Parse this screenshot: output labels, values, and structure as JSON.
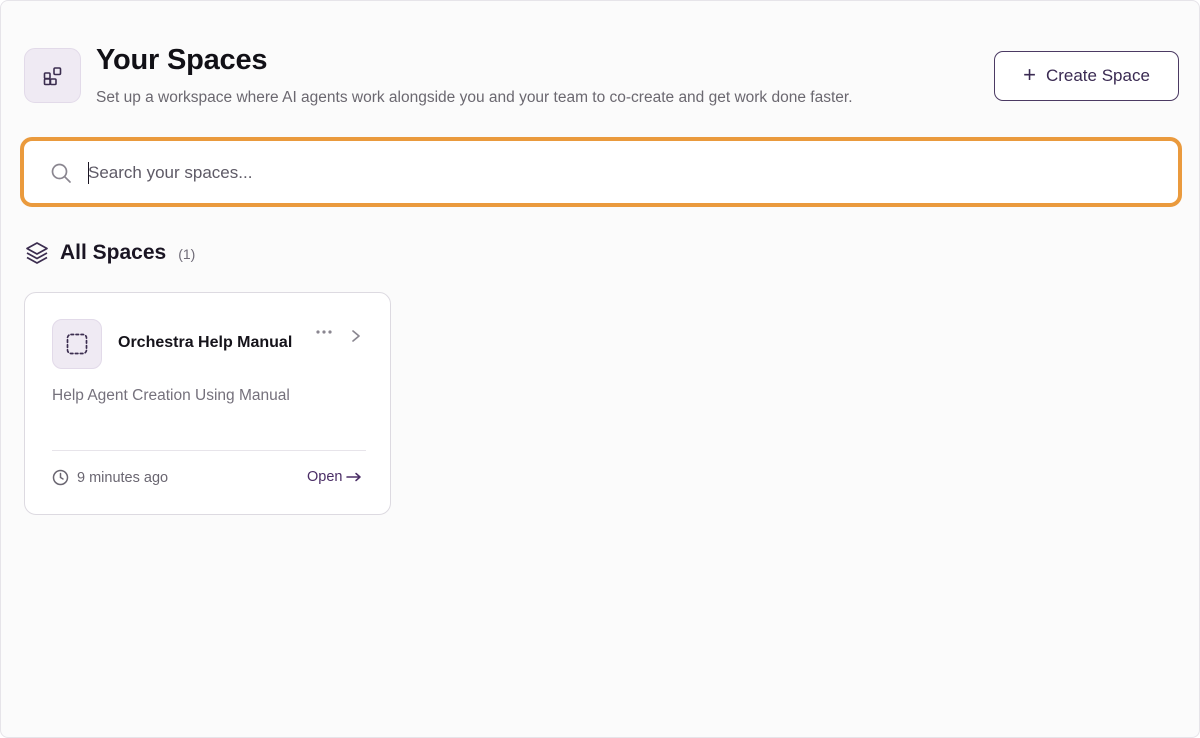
{
  "header": {
    "icon": "apps-grid-icon",
    "title": "Your Spaces",
    "subtitle": "Set up a workspace where AI agents work alongside you and your team to co-create and get work done faster.",
    "create_button": {
      "icon": "plus-icon",
      "label": "Create Space"
    }
  },
  "search": {
    "icon": "search-icon",
    "placeholder": "Search your spaces...",
    "value": ""
  },
  "section": {
    "icon": "layers-icon",
    "title": "All Spaces",
    "count": "(1)"
  },
  "spaces": [
    {
      "icon": "dashed-square-icon",
      "title": "Orchestra Help Manual",
      "description": "Help Agent Creation Using Manual",
      "time": "9 minutes ago",
      "open_label": "Open"
    }
  ],
  "colors": {
    "accent": "#4b3a63",
    "focus_ring": "#ea9a3d",
    "icon_tile": "#efeaf3"
  }
}
